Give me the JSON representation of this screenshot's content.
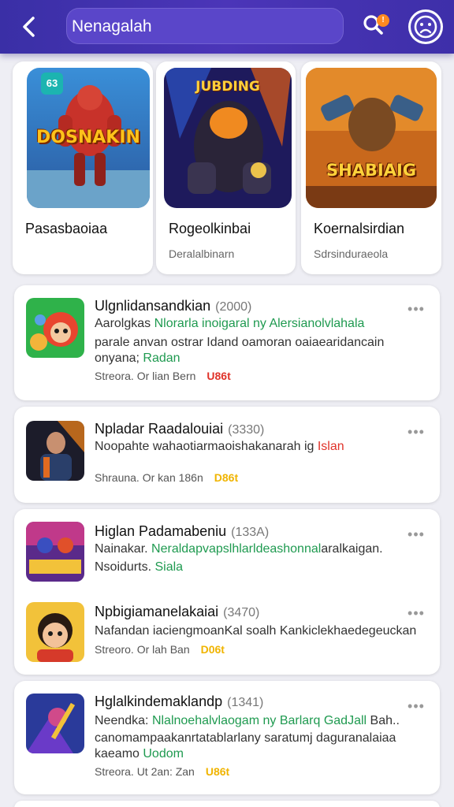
{
  "header": {
    "search_value": "Nenagalah",
    "notification_count": "!",
    "colors": {
      "bar": "#3f31ad",
      "accent": "#ff8a1f"
    }
  },
  "featured": [
    {
      "name": "Pasasbaoiaa",
      "sub": "",
      "art_text": "DOSNAKIN",
      "badge": "63"
    },
    {
      "name": "Rogeolkinbai",
      "sub": "Deralalbinarn",
      "art_text": "JUBDING"
    },
    {
      "name": "Koernalsirdian",
      "sub": "Sdrsinduraeola",
      "art_text": "SHABIAIG"
    }
  ],
  "list": [
    {
      "title": "Ulgnlidansandkian",
      "count": "(2000)",
      "line1_a": "Aarolgkas ",
      "line1_green": "Nlorarla inoigaral ny Alersianolvlahala",
      "line2": "parale anvan ostrar Idand oamoran oaiaearidancain",
      "line3_a": "onyana; ",
      "line3_green": "Radan",
      "meta": "Streora. Or lian Bern",
      "tag": "U86t"
    },
    {
      "title": "Npladar Raadalouiai",
      "count": "(3330)",
      "line1_a": "Noopahte wahaotiarmaoishakanarah ig ",
      "line1_red": "Islan",
      "meta": "Shrauna. Or kan 186n",
      "tag": "D86t"
    },
    {
      "title": "Higlan Padamabeniu",
      "count": "(133A)",
      "line1_a": "Nainakar. ",
      "line1_green": "Neraldapvapslhlarldeashonnal",
      "line1_b": "aralkaigan.",
      "line2_a": "Nsoidurts. ",
      "line2_green": "Siala"
    },
    {
      "title": "Npbigiamanelakaiai",
      "count": "(3470)",
      "line1_a": "Nafandan iaciengmoanKal soalh Kankiclekhaedegeuckan",
      "meta": "Streoro. Or lah Ban",
      "tag": "D06t"
    },
    {
      "title": "Hglalkindemaklandp",
      "count": "(1341)",
      "line1_a": "Neendka: ",
      "line1_green": "Nlalnoehalvlaogam ny Barlarq GadJall",
      "line1_b": " Bah..",
      "line2": "canomampaakanrtatablarlany saratumj daguranalaiaa",
      "line3_a": "kaeamo ",
      "line3_green": "Uodom",
      "meta": "Streora. Ut 2an: Zan",
      "tag": "U86t"
    }
  ]
}
